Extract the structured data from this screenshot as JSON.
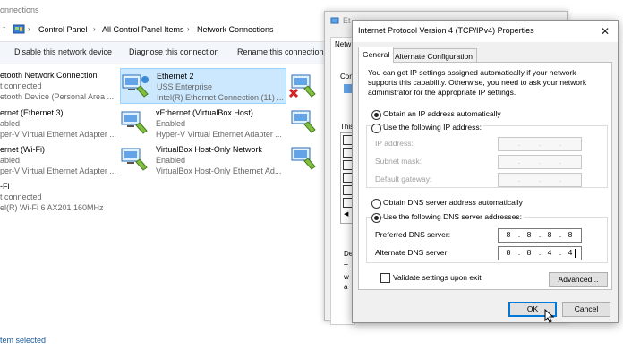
{
  "window": {
    "title_fragment": "onnections",
    "address": [
      "Control Panel",
      "All Control Panel Items",
      "Network Connections"
    ],
    "commands": [
      "Disable this network device",
      "Diagnose this connection",
      "Rename this connection"
    ],
    "status": "tem selected"
  },
  "connections": [
    {
      "name": "etooth Network Connection",
      "status": "t connected",
      "device": "etooth Device (Personal Area ..."
    },
    {
      "name": "Ethernet 2",
      "status": "USS Enterprise",
      "device": "Intel(R) Ethernet Connection (11) ..."
    },
    {
      "name": "ernet (Ethernet 3)",
      "status": "abled",
      "device": "per-V Virtual Ethernet Adapter ..."
    },
    {
      "name": "vEthernet (VirtualBox Host)",
      "status": "Enabled",
      "device": "Hyper-V Virtual Ethernet Adapter ..."
    },
    {
      "name": "ernet (Wi-Fi)",
      "status": "abled",
      "device": "per-V Virtual Ethernet Adapter ..."
    },
    {
      "name": "VirtualBox Host-Only Network",
      "status": "Enabled",
      "device": "VirtualBox Host-Only Ethernet Ad..."
    },
    {
      "name": "-Fi",
      "status": "t connected",
      "device": "el(R) Wi-Fi 6 AX201 160MHz"
    }
  ],
  "bg_dialog": {
    "title_fragment": "Et",
    "tab_fragment": "Netw",
    "label_con": "Con",
    "label_this": "This",
    "label_de": "De",
    "label_t1": "T",
    "label_t2": "w",
    "label_t3": "a"
  },
  "ip_dialog": {
    "title": "Internet Protocol Version 4 (TCP/IPv4) Properties",
    "close": "✕",
    "tabs": [
      "General",
      "Alternate Configuration"
    ],
    "description": "You can get IP settings assigned automatically if your network supports this capability. Otherwise, you need to ask your network administrator for the appropriate IP settings.",
    "ip_auto_label": "Obtain an IP address automatically",
    "ip_manual_label": "Use the following IP address:",
    "ip_fields": [
      {
        "label": "IP address:"
      },
      {
        "label": "Subnet mask:"
      },
      {
        "label": "Default gateway:"
      }
    ],
    "dns_auto_label": "Obtain DNS server address automatically",
    "dns_manual_label": "Use the following DNS server addresses:",
    "preferred_label": "Preferred DNS server:",
    "preferred_value": [
      "8",
      "8",
      "8",
      "8"
    ],
    "alternate_label": "Alternate DNS server:",
    "alternate_value": [
      "8",
      "8",
      "4",
      "4"
    ],
    "validate_label": "Validate settings upon exit",
    "advanced_button": "Advanced...",
    "ok_button": "OK",
    "cancel_button": "Cancel",
    "selected_ip_mode": "auto",
    "selected_dns_mode": "manual",
    "validate_checked": false
  },
  "colors": {
    "accent": "#0078d7",
    "selected_row": "#cce8ff",
    "cmdbar": "#f3f6fb",
    "dialog_bg": "#f0f0f0"
  }
}
